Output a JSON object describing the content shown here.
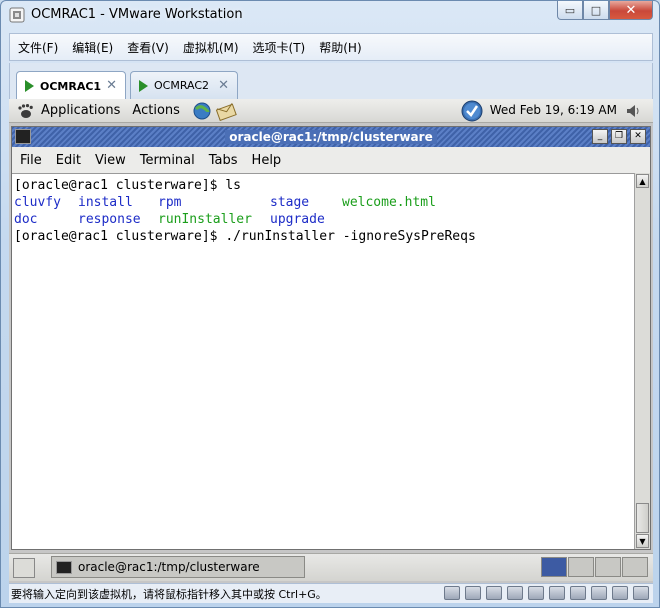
{
  "window": {
    "title": "OCMRAC1 - VMware Workstation",
    "minimize_glyph": "▭",
    "maximize_glyph": "□",
    "close_glyph": "✕"
  },
  "vmware_menu": [
    "文件(F)",
    "编辑(E)",
    "查看(V)",
    "虚拟机(M)",
    "选项卡(T)",
    "帮助(H)"
  ],
  "vmware_tabs": [
    {
      "label": "OCMRAC1",
      "active": true
    },
    {
      "label": "OCMRAC2",
      "active": false
    }
  ],
  "tab_close_glyph": "✕",
  "gnome_panel": {
    "menus": [
      "Applications",
      "Actions"
    ],
    "clock": "Wed Feb 19,  6:19 AM"
  },
  "terminal": {
    "title": "oracle@rac1:/tmp/clusterware",
    "buttons": [
      "_",
      "❐",
      "✕"
    ],
    "menu": [
      "File",
      "Edit",
      "View",
      "Terminal",
      "Tabs",
      "Help"
    ],
    "lines": [
      {
        "cells": [
          {
            "text": "[oracle@rac1 clusterware]$ ls",
            "color": "default"
          }
        ]
      },
      {
        "cells": [
          {
            "text": "cluvfy",
            "color": "blue"
          },
          {
            "text": "install",
            "color": "blue"
          },
          {
            "text": "rpm",
            "color": "blue"
          },
          {
            "text": "stage",
            "color": "blue"
          },
          {
            "text": "welcome.html",
            "color": "green"
          }
        ]
      },
      {
        "cells": [
          {
            "text": "doc",
            "color": "blue"
          },
          {
            "text": "response",
            "color": "blue"
          },
          {
            "text": "runInstaller",
            "color": "green"
          },
          {
            "text": "upgrade",
            "color": "blue"
          }
        ]
      },
      {
        "cells": [
          {
            "text": "[oracle@rac1 clusterware]$ ./runInstaller -ignoreSysPreReqs",
            "color": "default"
          }
        ]
      }
    ],
    "scroll_up": "▲",
    "scroll_down": "▼"
  },
  "taskbar": {
    "task_label": "oracle@rac1:/tmp/clusterware",
    "workspaces": 4,
    "active_workspace": 1
  },
  "vm_status": {
    "message": "要将输入定向到该虚拟机，请将鼠标指针移入其中或按 Ctrl+G。"
  },
  "colors": {
    "terminal_blue": "#1d2cc7",
    "terminal_green": "#1b9e1b",
    "title_blue": "#3f62a8"
  },
  "icons": {
    "app": "vmware-icon",
    "gnome_foot": "gnome-foot-icon",
    "update": "update-check-icon",
    "speaker": "speaker-icon"
  }
}
